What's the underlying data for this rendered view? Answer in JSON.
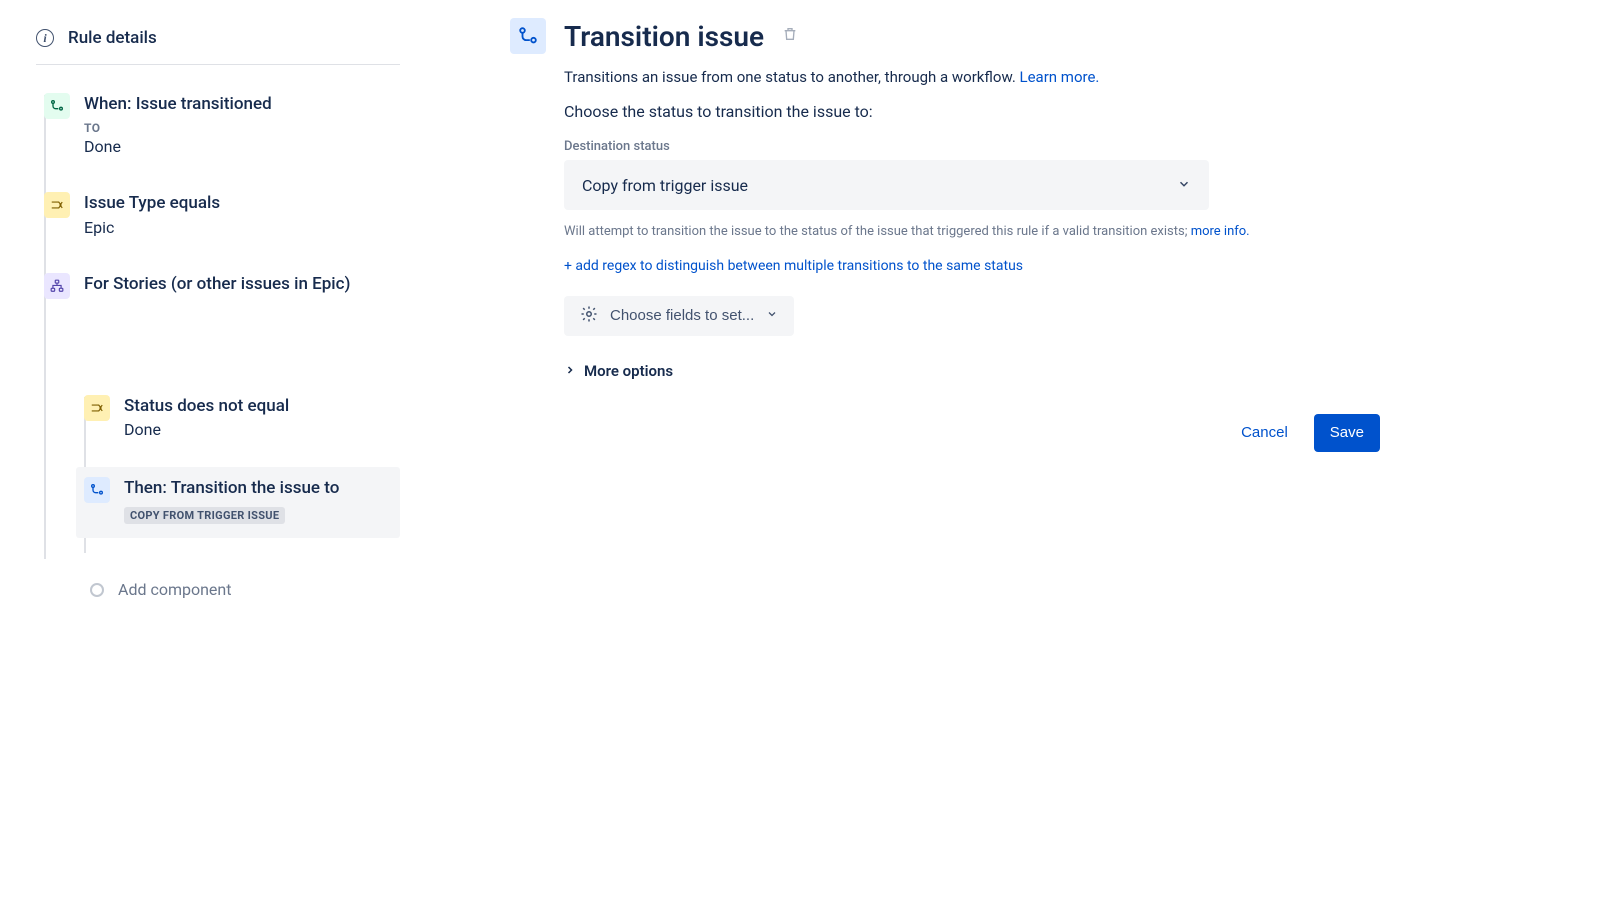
{
  "sidebar": {
    "rule_details_label": "Rule details",
    "nodes": {
      "trigger": {
        "title": "When: Issue transitioned",
        "subLabel": "TO",
        "sub": "Done"
      },
      "cond1": {
        "title": "Issue Type equals",
        "sub": "Epic"
      },
      "branch": {
        "title": "For Stories (or other issues in Epic)"
      },
      "cond2": {
        "title": "Status does not equal",
        "sub": "Done"
      },
      "action": {
        "title": "Then: Transition the issue to",
        "lozenge": "COPY FROM TRIGGER ISSUE"
      }
    },
    "add_component": "Add component"
  },
  "main": {
    "title": "Transition issue",
    "description": "Transitions an issue from one status to another, through a workflow. ",
    "learn_more": "Learn more.",
    "instruction": "Choose the status to transition the issue to:",
    "dest_label": "Destination status",
    "dest_value": "Copy from trigger issue",
    "helper_text": "Will attempt to transition the issue to the status of the issue that triggered this rule if a valid transition exists; ",
    "more_info": "more info.",
    "add_regex": "+ add regex to distinguish between multiple transitions to the same status",
    "choose_fields": "Choose fields to set...",
    "more_options": "More options",
    "cancel": "Cancel",
    "save": "Save"
  }
}
